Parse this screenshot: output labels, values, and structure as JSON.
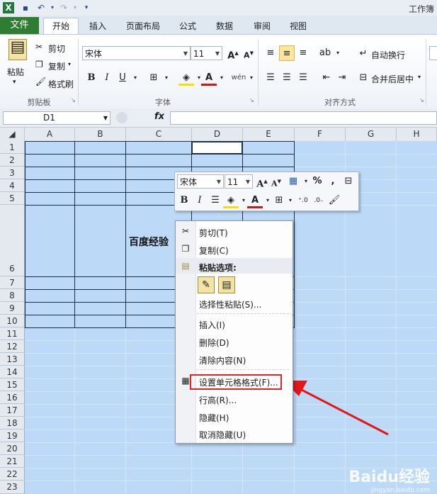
{
  "window": {
    "title": "工作簿"
  },
  "ribbon_tabs": [
    "文件",
    "开始",
    "插入",
    "页面布局",
    "公式",
    "数据",
    "审阅",
    "视图"
  ],
  "clipboard": {
    "paste": "粘贴",
    "cut": "剪切",
    "copy": "复制",
    "format_painter": "格式刷",
    "group": "剪贴板"
  },
  "font": {
    "name": "宋体",
    "size": "11",
    "group": "字体"
  },
  "align": {
    "wrap": "自动换行",
    "merge": "合并后居中",
    "group": "对齐方式"
  },
  "formula_bar": {
    "name_box": "D1",
    "fx": "fx"
  },
  "columns": [
    "A",
    "B",
    "C",
    "D",
    "E",
    "F",
    "G",
    "H"
  ],
  "rows": [
    "1",
    "2",
    "3",
    "4",
    "5",
    "6",
    "7",
    "8",
    "9",
    "10",
    "11",
    "12",
    "13",
    "14",
    "15",
    "16",
    "17",
    "18",
    "19",
    "20",
    "21",
    "22",
    "23"
  ],
  "cell_text": "百度经验",
  "mini_toolbar": {
    "font": "宋体",
    "size": "11",
    "percent": "%",
    "comma": ","
  },
  "context_menu": {
    "cut": "剪切(T)",
    "copy": "复制(C)",
    "paste_options": "粘贴选项:",
    "paste_special": "选择性粘贴(S)...",
    "insert": "插入(I)",
    "delete": "删除(D)",
    "clear": "清除内容(N)",
    "format_cells": "设置单元格格式(F)...",
    "row_height": "行高(R)...",
    "hide": "隐藏(H)",
    "unhide": "取消隐藏(U)"
  },
  "watermark": {
    "logo": "Baidu经验",
    "url": "jingyan.baidu.com"
  },
  "colors": {
    "file_tab": "#2f7d32",
    "selection": "#bcd9f7",
    "highlight_box": "#d62a2a"
  }
}
